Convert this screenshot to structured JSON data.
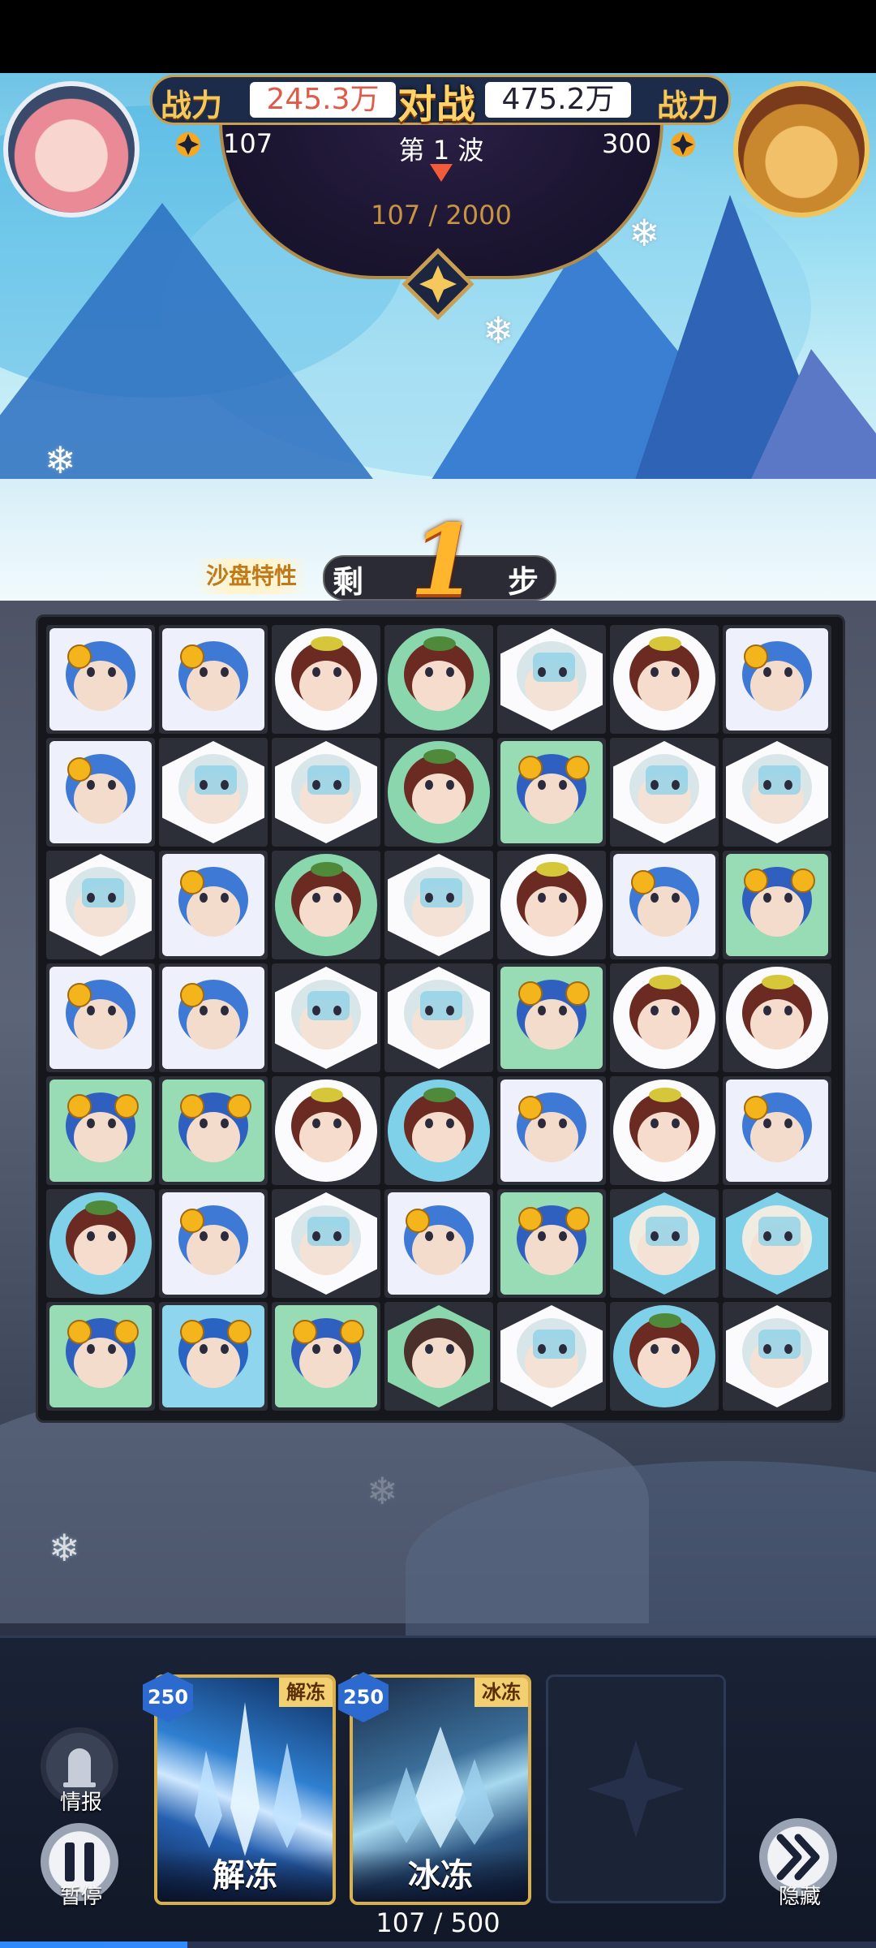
{
  "hud": {
    "left_power_label": "战力",
    "left_power_value": "245.3万",
    "vs_label": "对战",
    "right_power_value": "475.2万",
    "right_power_label": "战力",
    "left_coins": "107",
    "right_coins": "300",
    "wave_label": "第 1 波",
    "wave_progress": "107 / 2000"
  },
  "steps": {
    "feature_label": "沙盘特性",
    "remaining_prefix": "剩",
    "remaining_count": "1",
    "remaining_suffix": "步"
  },
  "board": {
    "rows": 7,
    "cols": 7,
    "tiles": [
      [
        "blue-girl",
        "blue-girl",
        "cat-boy",
        "frog-cat",
        "ice-girl",
        "cat-boy",
        "blue-girl"
      ],
      [
        "blue-girl",
        "ice-girl",
        "ice-girl",
        "frog-cat",
        "goggle-boy",
        "ice-girl",
        "ice-girl"
      ],
      [
        "ice-girl",
        "blue-girl",
        "frog-cat",
        "ice-girl",
        "cat-boy",
        "blue-girl",
        "goggle-boy"
      ],
      [
        "blue-girl",
        "blue-girl",
        "ice-girl",
        "ice-girl",
        "goggle-boy",
        "cat-boy",
        "cat-boy"
      ],
      [
        "goggle-boy",
        "goggle-boy",
        "cat-boy",
        "frog-cat-blue",
        "blue-girl",
        "cat-boy",
        "blue-girl"
      ],
      [
        "frog-cat-blue",
        "blue-girl",
        "ice-girl",
        "blue-girl",
        "goggle-boy",
        "nun-girl",
        "nun-girl"
      ],
      [
        "goggle-boy",
        "helmet-boy",
        "goggle-boy",
        "priest-girl",
        "ice-girl",
        "frog-cat-blue",
        "ice-girl"
      ]
    ]
  },
  "skills": [
    {
      "cost": "250",
      "tag": "解冻",
      "name": "解冻"
    },
    {
      "cost": "250",
      "tag": "冰冻",
      "name": "冰冻"
    }
  ],
  "buttons": {
    "intel_label": "情报",
    "pause_label": "暂停",
    "hide_label": "隐藏"
  },
  "energy": {
    "text": "107 / 500",
    "fraction": 0.214
  },
  "colors": {
    "accent_gold": "#f5c85b",
    "energy_blue": "#2f8bff",
    "power_red": "#e05a4a"
  }
}
